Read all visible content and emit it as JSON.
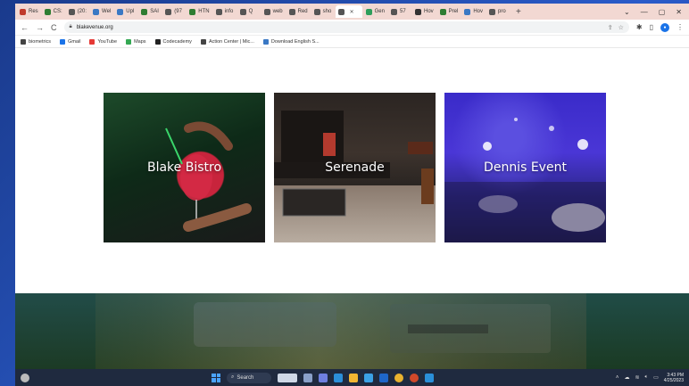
{
  "browser": {
    "tabs": [
      {
        "label": "Res",
        "color": "#c0392b"
      },
      {
        "label": "CS:",
        "color": "#2e7d32"
      },
      {
        "label": "(20:",
        "color": "#555555"
      },
      {
        "label": "Wel",
        "color": "#3a78c4"
      },
      {
        "label": "Upl",
        "color": "#3a78c4"
      },
      {
        "label": "SAI",
        "color": "#2e7d32"
      },
      {
        "label": "(97",
        "color": "#555555"
      },
      {
        "label": "HTN",
        "color": "#2e7d32"
      },
      {
        "label": "info",
        "color": "#555555"
      },
      {
        "label": "Q",
        "color": "#555555"
      },
      {
        "label": "web",
        "color": "#555555"
      },
      {
        "label": "Red",
        "color": "#555555"
      },
      {
        "label": "sho",
        "color": "#555555"
      },
      {
        "label": "",
        "color": "#555555",
        "active": true
      },
      {
        "label": "Gen",
        "color": "#2e9e5b"
      },
      {
        "label": "57",
        "color": "#555555"
      },
      {
        "label": "Hov",
        "color": "#333333"
      },
      {
        "label": "Prel",
        "color": "#2e7d32"
      },
      {
        "label": "Hov",
        "color": "#3a78c4"
      },
      {
        "label": "pro",
        "color": "#555555"
      }
    ],
    "new_tab": "+",
    "window_controls": [
      "⌄",
      "—",
      "▢",
      "✕"
    ],
    "url": "blakevenue.org",
    "bookmarks": [
      {
        "label": "biometrics",
        "color": "#444444"
      },
      {
        "label": "Gmail",
        "color": "#1a73e8"
      },
      {
        "label": "YouTube",
        "color": "#e53935"
      },
      {
        "label": "Maps",
        "color": "#34a853"
      },
      {
        "label": "Codecademy",
        "color": "#222222"
      },
      {
        "label": "Action Center | Mic...",
        "color": "#444444"
      },
      {
        "label": "Download English S...",
        "color": "#3a78c4"
      }
    ]
  },
  "venues": [
    {
      "name": "Blake Bistro"
    },
    {
      "name": "Serenade"
    },
    {
      "name": "Dennis Event"
    }
  ],
  "taskbar": {
    "search_label": "Search",
    "clock_time": "3:43 PM",
    "clock_date": "4/25/2023"
  }
}
